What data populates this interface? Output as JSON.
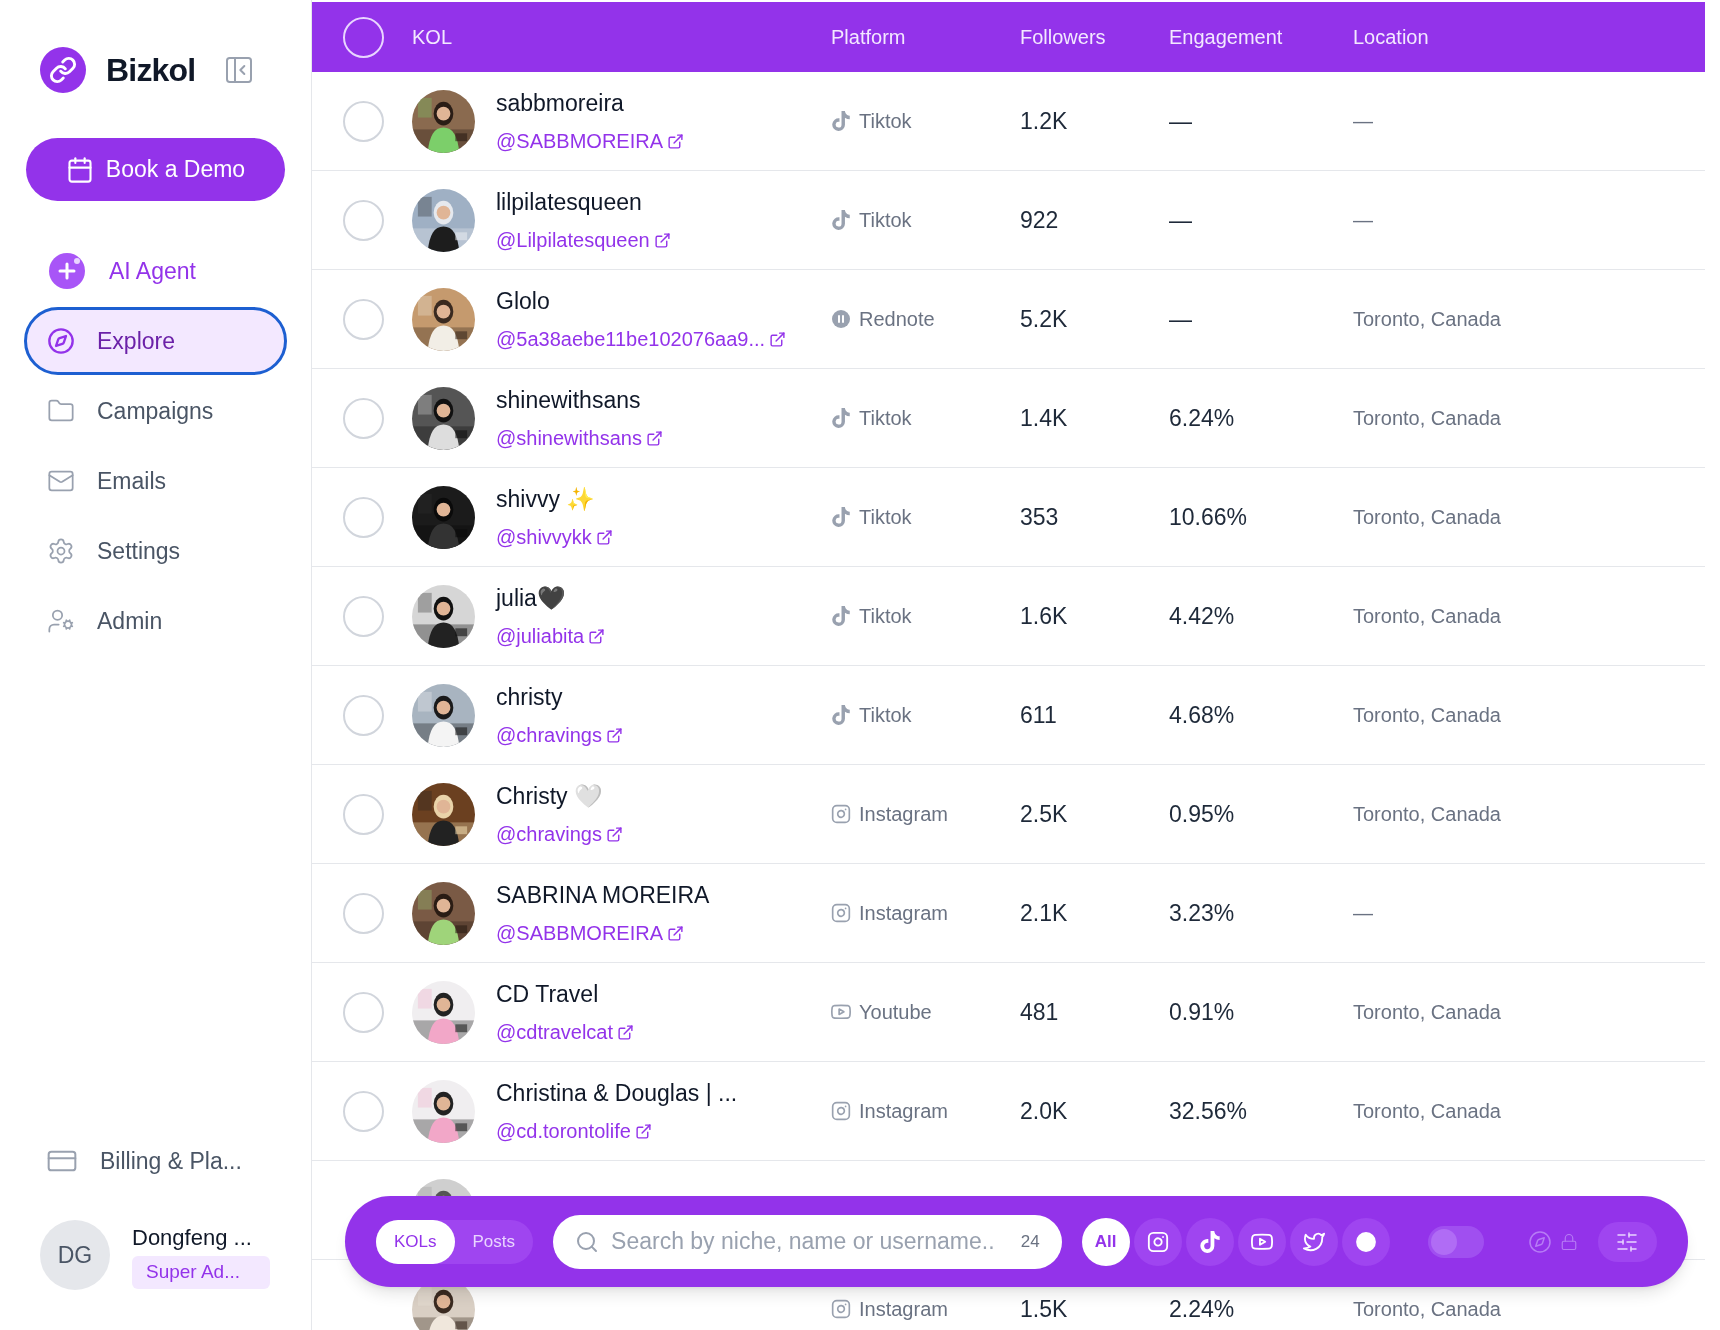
{
  "sidebar": {
    "brand": "Bizkol",
    "cta": "Book a Demo",
    "items": [
      {
        "label": "AI Agent",
        "kind": "agent",
        "selected": false
      },
      {
        "label": "Explore",
        "kind": "explore",
        "selected": true
      },
      {
        "label": "Campaigns",
        "kind": "campaigns",
        "selected": false
      },
      {
        "label": "Emails",
        "kind": "emails",
        "selected": false
      },
      {
        "label": "Settings",
        "kind": "settings",
        "selected": false
      },
      {
        "label": "Admin",
        "kind": "admin",
        "selected": false
      }
    ],
    "billing": "Billing & Pla...",
    "user": {
      "initials": "DG",
      "name": "Dongfeng ...",
      "role": "Super Ad..."
    }
  },
  "table": {
    "columns": [
      "KOL",
      "Platform",
      "Followers",
      "Engagement",
      "Location"
    ],
    "all_selected": false,
    "rows": [
      {
        "selected": false,
        "name": "sabbmoreira",
        "handle": "@SABBMOREIRA",
        "platform": {
          "kind": "tiktok",
          "label": "Tiktok"
        },
        "followers": "1.2K",
        "engagement": "—",
        "location": "—"
      },
      {
        "selected": false,
        "name": "lilpilatesqueen",
        "handle": "@Lilpilatesqueen",
        "platform": {
          "kind": "tiktok",
          "label": "Tiktok"
        },
        "followers": "922",
        "engagement": "—",
        "location": "—"
      },
      {
        "selected": false,
        "name": "Glolo",
        "handle": "@5a38aebe11be102076aa9...",
        "platform": {
          "kind": "rednote",
          "label": "Rednote"
        },
        "followers": "5.2K",
        "engagement": "—",
        "location": "Toronto, Canada"
      },
      {
        "selected": false,
        "name": "shinewithsans",
        "handle": "@shinewithsans",
        "platform": {
          "kind": "tiktok",
          "label": "Tiktok"
        },
        "followers": "1.4K",
        "engagement": "6.24%",
        "location": "Toronto, Canada"
      },
      {
        "selected": false,
        "name": "shivvy ✨",
        "handle": "@shivvykk",
        "platform": {
          "kind": "tiktok",
          "label": "Tiktok"
        },
        "followers": "353",
        "engagement": "10.66%",
        "location": "Toronto, Canada"
      },
      {
        "selected": false,
        "name": "julia🖤",
        "handle": "@juliabita",
        "platform": {
          "kind": "tiktok",
          "label": "Tiktok"
        },
        "followers": "1.6K",
        "engagement": "4.42%",
        "location": "Toronto, Canada"
      },
      {
        "selected": false,
        "name": "christy",
        "handle": "@chravings",
        "platform": {
          "kind": "tiktok",
          "label": "Tiktok"
        },
        "followers": "611",
        "engagement": "4.68%",
        "location": "Toronto, Canada"
      },
      {
        "selected": false,
        "name": "Christy 🤍",
        "handle": "@chravings",
        "platform": {
          "kind": "instagram",
          "label": "Instagram"
        },
        "followers": "2.5K",
        "engagement": "0.95%",
        "location": "Toronto, Canada"
      },
      {
        "selected": false,
        "name": "SABRINA MOREIRA",
        "handle": "@SABBMOREIRA",
        "platform": {
          "kind": "instagram",
          "label": "Instagram"
        },
        "followers": "2.1K",
        "engagement": "3.23%",
        "location": "—"
      },
      {
        "selected": false,
        "name": "CD Travel",
        "handle": "@cdtravelcat",
        "platform": {
          "kind": "youtube",
          "label": "Youtube"
        },
        "followers": "481",
        "engagement": "0.91%",
        "location": "Toronto, Canada"
      },
      {
        "selected": false,
        "name": "Christina & Douglas | ...",
        "handle": "@cd.torontolife",
        "platform": {
          "kind": "instagram",
          "label": "Instagram"
        },
        "followers": "2.0K",
        "engagement": "32.56%",
        "location": "Toronto, Canada"
      },
      {
        "kind": "picture"
      },
      {
        "kind": "picture",
        "platform": {
          "kind": "instagram",
          "label": "Instagram"
        },
        "followers": "1.5K",
        "engagement": "2.24%",
        "location": "Toronto, Canada"
      }
    ]
  },
  "toolbar": {
    "modes": [
      {
        "label": "KOLs",
        "selected": true
      },
      {
        "label": "Posts",
        "selected": false
      }
    ],
    "search": {
      "placeholder": "Search by niche, name or username..",
      "count": "24"
    },
    "filters": [
      {
        "kind": "all",
        "label": "All",
        "selected": true
      },
      {
        "kind": "instagram",
        "selected": false
      },
      {
        "kind": "tiktok",
        "selected": false
      },
      {
        "kind": "youtube",
        "selected": false
      },
      {
        "kind": "twitter",
        "selected": false
      },
      {
        "kind": "rednote",
        "selected": false
      }
    ],
    "toggle": {
      "on": false
    }
  }
}
